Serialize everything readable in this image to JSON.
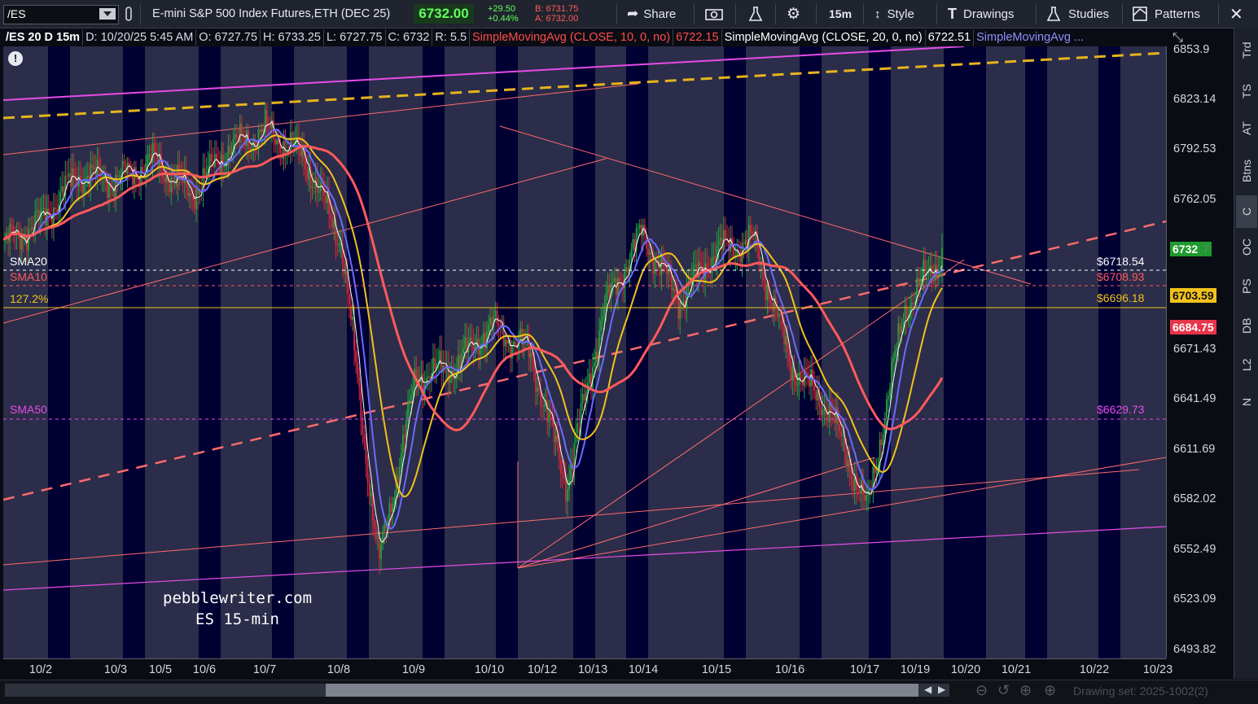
{
  "toolbar": {
    "symbol": "/ES",
    "description": "E-mini S&P 500 Index Futures,ETH (DEC 25)",
    "last_price": "6732.00",
    "change": "+29.50",
    "change_pct": "+0.44%",
    "bid": "B: 6731.75",
    "ask": "A: 6732.00",
    "share_label": "Share",
    "timeframe": "15m",
    "style_label": "Style",
    "drawings_label": "Drawings",
    "studies_label": "Studies",
    "patterns_label": "Patterns"
  },
  "header": {
    "title": "/ES 20 D 15m",
    "date": "D: 10/20/25 5:45 AM",
    "open": "O: 6727.75",
    "high": "H: 6733.25",
    "low": "L: 6727.75",
    "close": "C: 6732",
    "range": "R: 5.5",
    "sma10_label": "SimpleMovingAvg (CLOSE, 10, 0, no)",
    "sma10_value": "6722.15",
    "sma20_label": "SimpleMovingAvg (CLOSE, 20, 0, no)",
    "sma20_value": "6722.51",
    "sma_more": "SimpleMovingAvg ..."
  },
  "y_axis": {
    "ticks": [
      "6853.9",
      "6823.14",
      "6792.53",
      "6762.05",
      "6671.43",
      "6641.49",
      "6611.69",
      "6582.02",
      "6552.49",
      "6523.09",
      "6493.82"
    ],
    "tags": {
      "last": "6732",
      "last_suffix": "7",
      "sma20": "6703.59",
      "sma50": "6684.75"
    }
  },
  "x_axis": {
    "ticks": [
      "10/2",
      "10/3",
      "10/5",
      "10/6",
      "10/7",
      "10/8",
      "10/9",
      "10/10",
      "10/12",
      "10/13",
      "10/14",
      "10/15",
      "10/16",
      "10/17",
      "10/19",
      "10/20",
      "10/21",
      "10/22",
      "10/23"
    ]
  },
  "annotations": {
    "sma20_name": "SMA20",
    "sma10_name": "SMA10",
    "fib_level": "127.2%",
    "sma50_name": "SMA50",
    "sma20_price": "$6718.54",
    "sma10_price": "$6708.93",
    "fib_price": "$6696.18",
    "sma50_price": "$6629.73"
  },
  "watermark": {
    "line1": "pebblewriter.com",
    "line2": "ES 15-min"
  },
  "side_tabs": [
    "Trd",
    "TS",
    "AT",
    "Btns",
    "C",
    "OC",
    "PS",
    "DB",
    "L2",
    "N"
  ],
  "footer": {
    "drawing_set": "Drawing set: 2025-1002(2)"
  },
  "colors": {
    "background": "#0a0c14",
    "band_light": "#2b2d4a",
    "band_dark": "#000033",
    "candle_up": "#22a33a",
    "candle_down": "#d12a3a",
    "sma10": "#ffffff",
    "sma20": "#6b6bff",
    "sma50": "#f2c21b",
    "sma100": "#ff5a5a",
    "channel_magenta": "#e64ce6",
    "channel_dashed_gold": "#e6b41e"
  },
  "chart_data": {
    "type": "candlestick",
    "symbol": "/ES",
    "interval": "15m",
    "ylim": [
      6493.82,
      6853.9
    ],
    "x": [
      "10/2",
      "10/3",
      "10/6",
      "10/7",
      "10/8",
      "10/9",
      "10/10",
      "10/12",
      "10/13",
      "10/14",
      "10/15",
      "10/16",
      "10/17",
      "10/19",
      "10/20"
    ],
    "close_path": [
      6738,
      6752,
      6780,
      6776,
      6788,
      6768,
      6795,
      6806,
      6790,
      6740,
      6548,
      6660,
      6665,
      6690,
      6675,
      6595,
      6700,
      6745,
      6705,
      6735,
      6740,
      6665,
      6640,
      6580,
      6700,
      6732
    ],
    "series": [
      {
        "name": "SMA10",
        "last": 6722.15
      },
      {
        "name": "SMA20",
        "last": 6722.51
      }
    ]
  }
}
